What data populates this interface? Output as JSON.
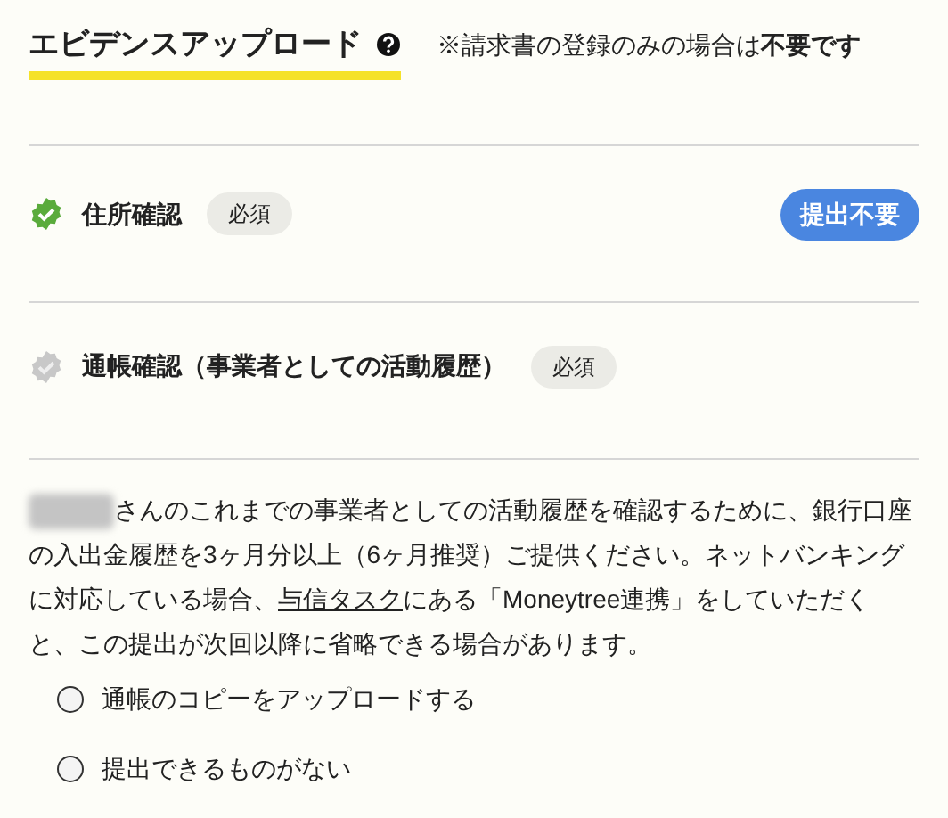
{
  "header": {
    "title": "エビデンスアップロード",
    "note": "※請求書の登録のみの場合は**不要です**"
  },
  "items": [
    {
      "label": "住所確認",
      "checked": true,
      "badge": "必須",
      "action": "提出不要"
    },
    {
      "label": "通帳確認（事業者としての活動履歴）",
      "checked": false,
      "badge": "必須"
    }
  ],
  "description": {
    "before": "さんのこれまでの事業者としての活動履歴を確認するために、銀行口座の入出金履歴を3ヶ月分以上（6ヶ月推奨）ご提供ください。ネットバンキングに対応している場合、",
    "link": "与信タスク",
    "after": "にある「Moneytree連携」をしていただくと、この提出が次回以降に省略できる場合があります。"
  },
  "options": [
    {
      "label": "通帳のコピーをアップロードする",
      "selected": false
    },
    {
      "label": "提出できるものがない",
      "selected": false
    }
  ]
}
